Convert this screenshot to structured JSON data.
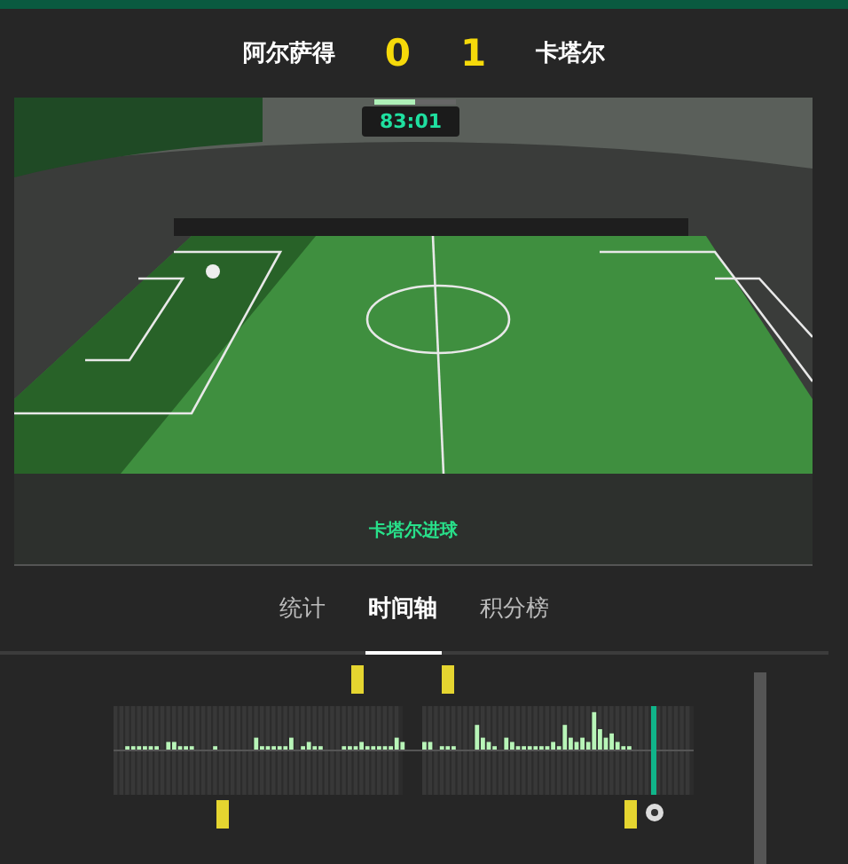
{
  "match": {
    "home": "阿尔萨得",
    "home_score": "0",
    "away_score": "1",
    "away": "卡塔尔",
    "progress": {
      "level": 0.5
    }
  },
  "live": {
    "clock": "83:01",
    "event": "卡塔尔进球"
  },
  "tabs": [
    {
      "label": "统计",
      "selected": false
    },
    {
      "label": "时间轴",
      "selected": true
    },
    {
      "label": "积分榜",
      "selected": false
    }
  ]
}
